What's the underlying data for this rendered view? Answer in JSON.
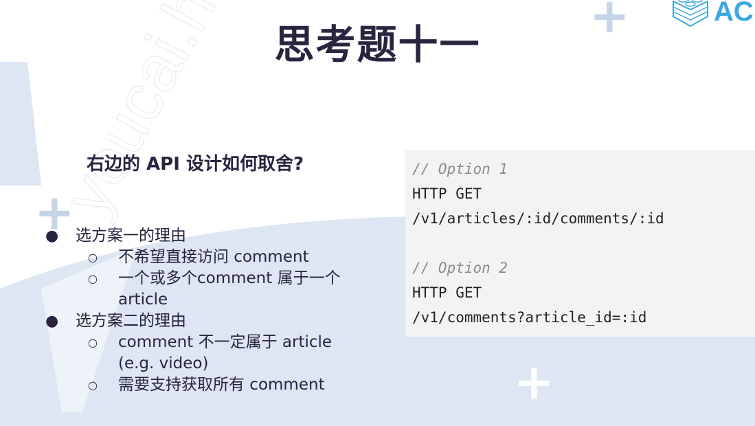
{
  "slide": {
    "title": "思考题十一",
    "subtitle": "右边的 API 设计如何取舍?",
    "bullets": [
      {
        "label": "选方案一的理由",
        "children": [
          "不希望直接访问 comment",
          "一个或多个comment 属于一个 article"
        ]
      },
      {
        "label": "选方案二的理由",
        "children": [
          "comment 不一定属于 article (e.g. video)",
          "需要支持获取所有 comment"
        ]
      }
    ],
    "code": {
      "option1_comment": "// Option 1",
      "option1_method": "HTTP GET",
      "option1_path": "/v1/articles/:id/comments/:id",
      "option2_comment": "// Option 2",
      "option2_method": "HTTP GET",
      "option2_path": "/v1/comments?article_id=:id"
    }
  },
  "logo": {
    "text": "AC"
  },
  "watermark": "youcai.huxin",
  "colors": {
    "title": "#2a2440",
    "background_shape": "#dde6f2",
    "code_bg": "#f3f3f3",
    "logo": "#3da8e0"
  }
}
